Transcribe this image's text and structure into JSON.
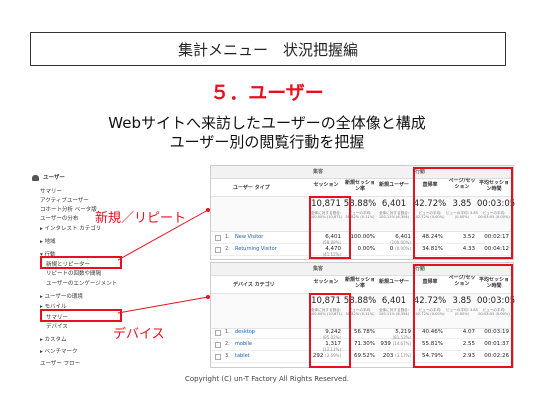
{
  "slide": {
    "title": "集計メニュー　状況把握編",
    "section": "５．ユーザー",
    "subtitle_line1": "Webサイトへ来訪したユーザーの全体像と構成",
    "subtitle_line2": "ユーザー別の閲覧行動を把握",
    "callout_new_repeat": "新規／リピート",
    "callout_device": "デバイス",
    "copyright": "Copyright (C) un-T Factory  All Rights Reserved."
  },
  "sidebar": {
    "header": "ユーザー",
    "items": [
      "サマリー",
      "アクティブユーザー",
      "コホート分析 ベータ版",
      "ユーザーの分布",
      "▸ インタレスト カテゴリ",
      "▸ 地域",
      "▾ 行動",
      "新規とリピーター",
      "リピートの回数や間隔",
      "ユーザーのエンゲージメント",
      "▸ ユーザーの環境",
      "▸ モバイル",
      "サマリー",
      "デバイス",
      "▸ カスタム",
      "▸ ベンチマーク",
      "ユーザー フロー"
    ]
  },
  "table1": {
    "group_acq": "集客",
    "group_beh": "行動",
    "dim_header": "ユーザー タイプ",
    "headers": [
      "セッション",
      "新規セッション率",
      "新規ユーザー",
      "直帰率",
      "ページ/セッション",
      "平均セッション時間"
    ],
    "totals": [
      "10,871",
      "58.88%",
      "6,401",
      "42.72%",
      "3.85",
      "00:03:05"
    ],
    "totals_sub": [
      "全体に対する割合: 100.00% (10,871)",
      "ビューの平均: 58.82% (0.11%)",
      "全体に対する割合: 100.11% (6,394)",
      "ビューの平均: 42.72% (0.00%)",
      "ビューの平均: 3.85 (0.00%)",
      "ビューの平均: 00:03:05 (0.00%)"
    ],
    "rows": [
      {
        "idx": "1.",
        "label": "New Visitor",
        "sessions": "6,401",
        "sessions_pct": "(58.88%)",
        "new_rate": "100.00%",
        "new_users": "6,401",
        "new_users_pct": "(100.00%)",
        "bounce": "48.24%",
        "pps": "3.52",
        "avg": "00:02:17"
      },
      {
        "idx": "2.",
        "label": "Returning Visitor",
        "sessions": "4,470",
        "sessions_pct": "(41.12%)",
        "new_rate": "0.00%",
        "new_users": "0",
        "new_users_pct": "(0.00%)",
        "bounce": "34.81%",
        "pps": "4.33",
        "avg": "00:04:12"
      }
    ]
  },
  "table2": {
    "group_acq": "集客",
    "group_beh": "行動",
    "dim_header": "デバイス カテゴリ",
    "headers": [
      "セッション",
      "新規セッション率",
      "新規ユーザー",
      "直帰率",
      "ページ/セッション",
      "平均セッション時間"
    ],
    "totals": [
      "10,871",
      "58.88%",
      "6,401",
      "42.72%",
      "3.85",
      "00:03:05"
    ],
    "totals_sub": [
      "全体に対する割合: 100.00% (10,871)",
      "ビューの平均: 58.82% (0.11%)",
      "全体に対する割合: 100.11% (6,394)",
      "ビューの平均: 42.72% (0.00%)",
      "ビューの平均: 3.85 (0.00%)",
      "ビューの平均: 00:03:05 (0.00%)"
    ],
    "rows": [
      {
        "idx": "1.",
        "label": "desktop",
        "sessions": "9,242",
        "sessions_pct": "(85.02%)",
        "new_rate": "56.78%",
        "new_users": "5,219",
        "new_users_pct": "(81.53%)",
        "bounce": "40.46%",
        "pps": "4.07",
        "avg": "00:03:19"
      },
      {
        "idx": "2.",
        "label": "mobile",
        "sessions": "1,317",
        "sessions_pct": "(12.11%)",
        "new_rate": "71.30%",
        "new_users": "939",
        "new_users_pct": "(14.67%)",
        "bounce": "55.81%",
        "pps": "2.55",
        "avg": "00:01:37"
      },
      {
        "idx": "3.",
        "label": "tablet",
        "sessions": "292",
        "sessions_pct": "(2.69%)",
        "new_rate": "69.52%",
        "new_users": "203",
        "new_users_pct": "(3.17%)",
        "bounce": "54.79%",
        "pps": "2.93",
        "avg": "00:02:26"
      }
    ]
  }
}
